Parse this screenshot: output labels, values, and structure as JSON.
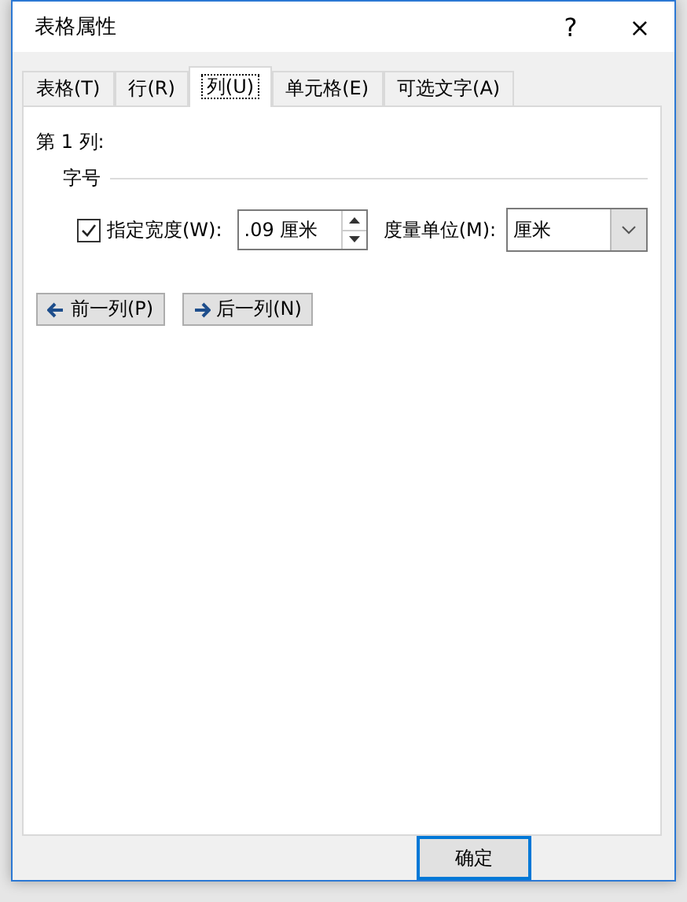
{
  "window": {
    "title": "表格属性",
    "help": "?",
    "close": "×"
  },
  "tabs": [
    {
      "label": "表格(T)",
      "selected": false
    },
    {
      "label": "行(R)",
      "selected": false
    },
    {
      "label": "列(U)",
      "selected": true
    },
    {
      "label": "单元格(E)",
      "selected": false
    },
    {
      "label": "可选文字(A)",
      "selected": false
    }
  ],
  "column_heading": "第 1 列:",
  "section": "字号",
  "width": {
    "checked": true,
    "label": "指定宽度(W):",
    "value": ".09 厘米"
  },
  "unit": {
    "label": "度量单位(M):",
    "value": "厘米"
  },
  "nav_buttons": [
    {
      "kind": "prev",
      "label": "前一列(P)"
    },
    {
      "kind": "next",
      "label": "后一列(N)"
    }
  ],
  "ok_button": "确定"
}
